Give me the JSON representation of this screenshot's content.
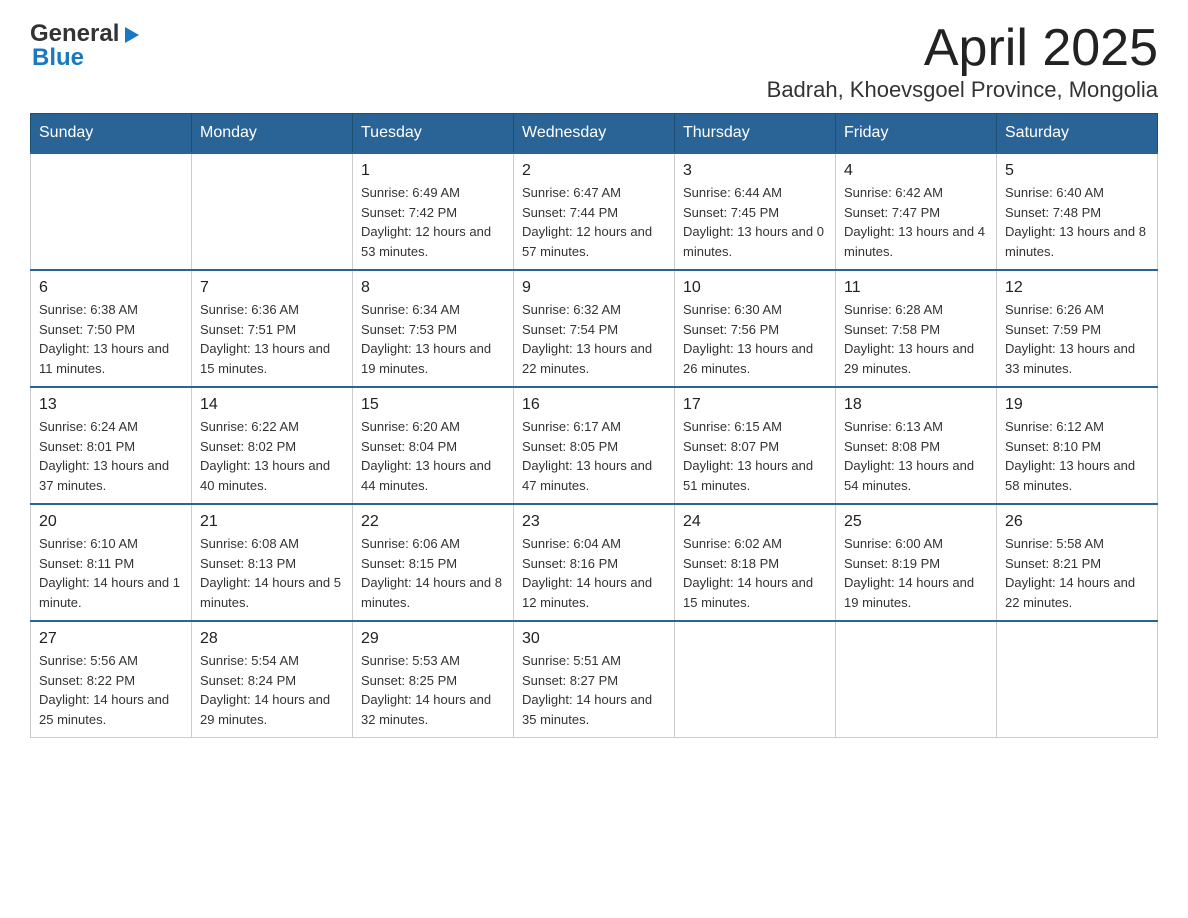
{
  "logo": {
    "general": "General",
    "blue": "Blue"
  },
  "title": "April 2025",
  "subtitle": "Badrah, Khoevsgoel Province, Mongolia",
  "weekdays": [
    "Sunday",
    "Monday",
    "Tuesday",
    "Wednesday",
    "Thursday",
    "Friday",
    "Saturday"
  ],
  "weeks": [
    [
      {
        "day": "",
        "sunrise": "",
        "sunset": "",
        "daylight": ""
      },
      {
        "day": "",
        "sunrise": "",
        "sunset": "",
        "daylight": ""
      },
      {
        "day": "1",
        "sunrise": "Sunrise: 6:49 AM",
        "sunset": "Sunset: 7:42 PM",
        "daylight": "Daylight: 12 hours and 53 minutes."
      },
      {
        "day": "2",
        "sunrise": "Sunrise: 6:47 AM",
        "sunset": "Sunset: 7:44 PM",
        "daylight": "Daylight: 12 hours and 57 minutes."
      },
      {
        "day": "3",
        "sunrise": "Sunrise: 6:44 AM",
        "sunset": "Sunset: 7:45 PM",
        "daylight": "Daylight: 13 hours and 0 minutes."
      },
      {
        "day": "4",
        "sunrise": "Sunrise: 6:42 AM",
        "sunset": "Sunset: 7:47 PM",
        "daylight": "Daylight: 13 hours and 4 minutes."
      },
      {
        "day": "5",
        "sunrise": "Sunrise: 6:40 AM",
        "sunset": "Sunset: 7:48 PM",
        "daylight": "Daylight: 13 hours and 8 minutes."
      }
    ],
    [
      {
        "day": "6",
        "sunrise": "Sunrise: 6:38 AM",
        "sunset": "Sunset: 7:50 PM",
        "daylight": "Daylight: 13 hours and 11 minutes."
      },
      {
        "day": "7",
        "sunrise": "Sunrise: 6:36 AM",
        "sunset": "Sunset: 7:51 PM",
        "daylight": "Daylight: 13 hours and 15 minutes."
      },
      {
        "day": "8",
        "sunrise": "Sunrise: 6:34 AM",
        "sunset": "Sunset: 7:53 PM",
        "daylight": "Daylight: 13 hours and 19 minutes."
      },
      {
        "day": "9",
        "sunrise": "Sunrise: 6:32 AM",
        "sunset": "Sunset: 7:54 PM",
        "daylight": "Daylight: 13 hours and 22 minutes."
      },
      {
        "day": "10",
        "sunrise": "Sunrise: 6:30 AM",
        "sunset": "Sunset: 7:56 PM",
        "daylight": "Daylight: 13 hours and 26 minutes."
      },
      {
        "day": "11",
        "sunrise": "Sunrise: 6:28 AM",
        "sunset": "Sunset: 7:58 PM",
        "daylight": "Daylight: 13 hours and 29 minutes."
      },
      {
        "day": "12",
        "sunrise": "Sunrise: 6:26 AM",
        "sunset": "Sunset: 7:59 PM",
        "daylight": "Daylight: 13 hours and 33 minutes."
      }
    ],
    [
      {
        "day": "13",
        "sunrise": "Sunrise: 6:24 AM",
        "sunset": "Sunset: 8:01 PM",
        "daylight": "Daylight: 13 hours and 37 minutes."
      },
      {
        "day": "14",
        "sunrise": "Sunrise: 6:22 AM",
        "sunset": "Sunset: 8:02 PM",
        "daylight": "Daylight: 13 hours and 40 minutes."
      },
      {
        "day": "15",
        "sunrise": "Sunrise: 6:20 AM",
        "sunset": "Sunset: 8:04 PM",
        "daylight": "Daylight: 13 hours and 44 minutes."
      },
      {
        "day": "16",
        "sunrise": "Sunrise: 6:17 AM",
        "sunset": "Sunset: 8:05 PM",
        "daylight": "Daylight: 13 hours and 47 minutes."
      },
      {
        "day": "17",
        "sunrise": "Sunrise: 6:15 AM",
        "sunset": "Sunset: 8:07 PM",
        "daylight": "Daylight: 13 hours and 51 minutes."
      },
      {
        "day": "18",
        "sunrise": "Sunrise: 6:13 AM",
        "sunset": "Sunset: 8:08 PM",
        "daylight": "Daylight: 13 hours and 54 minutes."
      },
      {
        "day": "19",
        "sunrise": "Sunrise: 6:12 AM",
        "sunset": "Sunset: 8:10 PM",
        "daylight": "Daylight: 13 hours and 58 minutes."
      }
    ],
    [
      {
        "day": "20",
        "sunrise": "Sunrise: 6:10 AM",
        "sunset": "Sunset: 8:11 PM",
        "daylight": "Daylight: 14 hours and 1 minute."
      },
      {
        "day": "21",
        "sunrise": "Sunrise: 6:08 AM",
        "sunset": "Sunset: 8:13 PM",
        "daylight": "Daylight: 14 hours and 5 minutes."
      },
      {
        "day": "22",
        "sunrise": "Sunrise: 6:06 AM",
        "sunset": "Sunset: 8:15 PM",
        "daylight": "Daylight: 14 hours and 8 minutes."
      },
      {
        "day": "23",
        "sunrise": "Sunrise: 6:04 AM",
        "sunset": "Sunset: 8:16 PM",
        "daylight": "Daylight: 14 hours and 12 minutes."
      },
      {
        "day": "24",
        "sunrise": "Sunrise: 6:02 AM",
        "sunset": "Sunset: 8:18 PM",
        "daylight": "Daylight: 14 hours and 15 minutes."
      },
      {
        "day": "25",
        "sunrise": "Sunrise: 6:00 AM",
        "sunset": "Sunset: 8:19 PM",
        "daylight": "Daylight: 14 hours and 19 minutes."
      },
      {
        "day": "26",
        "sunrise": "Sunrise: 5:58 AM",
        "sunset": "Sunset: 8:21 PM",
        "daylight": "Daylight: 14 hours and 22 minutes."
      }
    ],
    [
      {
        "day": "27",
        "sunrise": "Sunrise: 5:56 AM",
        "sunset": "Sunset: 8:22 PM",
        "daylight": "Daylight: 14 hours and 25 minutes."
      },
      {
        "day": "28",
        "sunrise": "Sunrise: 5:54 AM",
        "sunset": "Sunset: 8:24 PM",
        "daylight": "Daylight: 14 hours and 29 minutes."
      },
      {
        "day": "29",
        "sunrise": "Sunrise: 5:53 AM",
        "sunset": "Sunset: 8:25 PM",
        "daylight": "Daylight: 14 hours and 32 minutes."
      },
      {
        "day": "30",
        "sunrise": "Sunrise: 5:51 AM",
        "sunset": "Sunset: 8:27 PM",
        "daylight": "Daylight: 14 hours and 35 minutes."
      },
      {
        "day": "",
        "sunrise": "",
        "sunset": "",
        "daylight": ""
      },
      {
        "day": "",
        "sunrise": "",
        "sunset": "",
        "daylight": ""
      },
      {
        "day": "",
        "sunrise": "",
        "sunset": "",
        "daylight": ""
      }
    ]
  ]
}
